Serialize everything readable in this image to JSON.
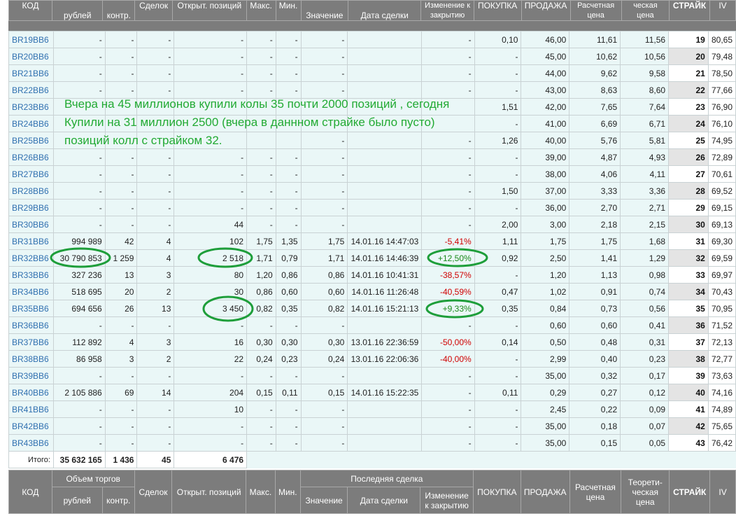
{
  "header_top": {
    "code": "КОД",
    "rub": "рублей",
    "contr": "контр.",
    "deals": "Сделок",
    "open_pos": "Открыт. позиций",
    "max": "Макс.",
    "min": "Мин.",
    "value": "Значение",
    "deal_date": "Дата сделки",
    "change": "Изменение к закрытию",
    "buy": "ПОКУПКА",
    "sell": "ПРОДАЖА",
    "calc_price": "Расчетная цена",
    "theor_price": "ческая цена",
    "strike": "СТРАЙК",
    "iv": "IV"
  },
  "rows": [
    {
      "code": "BR19BB6",
      "rub": "-",
      "contr": "-",
      "deals": "-",
      "open_pos": "-",
      "max": "-",
      "min": "-",
      "value": "-",
      "date": "",
      "chg": "-",
      "buy": "0,10",
      "sell": "46,00",
      "calc": "11,61",
      "theor": "11,56",
      "strike": "19",
      "iv": "80,65"
    },
    {
      "code": "BR20BB6",
      "rub": "-",
      "contr": "-",
      "deals": "-",
      "open_pos": "-",
      "max": "-",
      "min": "-",
      "value": "-",
      "date": "",
      "chg": "-",
      "buy": "-",
      "sell": "45,00",
      "calc": "10,62",
      "theor": "10,56",
      "strike": "20",
      "iv": "79,48"
    },
    {
      "code": "BR21BB6",
      "rub": "-",
      "contr": "-",
      "deals": "-",
      "open_pos": "-",
      "max": "-",
      "min": "-",
      "value": "-",
      "date": "",
      "chg": "-",
      "buy": "-",
      "sell": "44,00",
      "calc": "9,62",
      "theor": "9,58",
      "strike": "21",
      "iv": "78,50"
    },
    {
      "code": "BR22BB6",
      "rub": "-",
      "contr": "-",
      "deals": "-",
      "open_pos": "-",
      "max": "-",
      "min": "-",
      "value": "-",
      "date": "",
      "chg": "-",
      "buy": "-",
      "sell": "43,00",
      "calc": "8,63",
      "theor": "8,60",
      "strike": "22",
      "iv": "77,66"
    },
    {
      "code": "BR23BB6",
      "rub": "",
      "contr": "",
      "deals": "",
      "open_pos": "",
      "max": "",
      "min": "",
      "value": "",
      "date": "",
      "chg": "",
      "buy": "1,51",
      "sell": "42,00",
      "calc": "7,65",
      "theor": "7,64",
      "strike": "23",
      "iv": "76,90"
    },
    {
      "code": "BR24BB6",
      "rub": "",
      "contr": "",
      "deals": "",
      "open_pos": "",
      "max": "",
      "min": "",
      "value": "",
      "date": "",
      "chg": "",
      "buy": "-",
      "sell": "41,00",
      "calc": "6,69",
      "theor": "6,71",
      "strike": "24",
      "iv": "76,10"
    },
    {
      "code": "BR25BB6",
      "rub": "",
      "contr": "",
      "deals": "",
      "open_pos": "",
      "max": "",
      "min": "",
      "value": "-",
      "date": "",
      "chg": "-",
      "buy": "1,26",
      "sell": "40,00",
      "calc": "5,76",
      "theor": "5,81",
      "strike": "25",
      "iv": "74,95"
    },
    {
      "code": "BR26BB6",
      "rub": "-",
      "contr": "-",
      "deals": "-",
      "open_pos": "-",
      "max": "-",
      "min": "-",
      "value": "-",
      "date": "",
      "chg": "-",
      "buy": "-",
      "sell": "39,00",
      "calc": "4,87",
      "theor": "4,93",
      "strike": "26",
      "iv": "72,89"
    },
    {
      "code": "BR27BB6",
      "rub": "-",
      "contr": "-",
      "deals": "-",
      "open_pos": "-",
      "max": "-",
      "min": "-",
      "value": "-",
      "date": "",
      "chg": "-",
      "buy": "-",
      "sell": "38,00",
      "calc": "4,06",
      "theor": "4,11",
      "strike": "27",
      "iv": "70,61"
    },
    {
      "code": "BR28BB6",
      "rub": "-",
      "contr": "-",
      "deals": "-",
      "open_pos": "-",
      "max": "-",
      "min": "-",
      "value": "-",
      "date": "",
      "chg": "-",
      "buy": "1,50",
      "sell": "37,00",
      "calc": "3,33",
      "theor": "3,36",
      "strike": "28",
      "iv": "69,52"
    },
    {
      "code": "BR29BB6",
      "rub": "-",
      "contr": "-",
      "deals": "-",
      "open_pos": "-",
      "max": "-",
      "min": "-",
      "value": "-",
      "date": "",
      "chg": "-",
      "buy": "-",
      "sell": "36,00",
      "calc": "2,70",
      "theor": "2,71",
      "strike": "29",
      "iv": "69,15"
    },
    {
      "code": "BR30BB6",
      "rub": "-",
      "contr": "-",
      "deals": "-",
      "open_pos": "44",
      "max": "-",
      "min": "-",
      "value": "-",
      "date": "",
      "chg": "-",
      "buy": "2,00",
      "sell": "3,00",
      "calc": "2,18",
      "theor": "2,15",
      "strike": "30",
      "iv": "69,13"
    },
    {
      "code": "BR31BB6",
      "rub": "994 989",
      "contr": "42",
      "deals": "4",
      "open_pos": "102",
      "max": "1,75",
      "min": "1,35",
      "value": "1,75",
      "date": "14.01.16 14:47:03",
      "chg": "-5,41%",
      "buy": "1,11",
      "sell": "1,75",
      "calc": "1,75",
      "theor": "1,68",
      "strike": "31",
      "iv": "69,30"
    },
    {
      "code": "BR32BB6",
      "rub": "30 790 853",
      "contr": "1 259",
      "deals": "4",
      "open_pos": "2 518",
      "max": "1,71",
      "min": "0,79",
      "value": "1,71",
      "date": "14.01.16 14:46:39",
      "chg": "+12,50%",
      "buy": "0,92",
      "sell": "2,50",
      "calc": "1,41",
      "theor": "1,29",
      "strike": "32",
      "iv": "69,59"
    },
    {
      "code": "BR33BB6",
      "rub": "327 236",
      "contr": "13",
      "deals": "3",
      "open_pos": "80",
      "max": "1,20",
      "min": "0,86",
      "value": "0,86",
      "date": "14.01.16 10:41:31",
      "chg": "-38,57%",
      "buy": "-",
      "sell": "1,20",
      "calc": "1,13",
      "theor": "0,98",
      "strike": "33",
      "iv": "69,97"
    },
    {
      "code": "BR34BB6",
      "rub": "518 695",
      "contr": "20",
      "deals": "2",
      "open_pos": "30",
      "max": "0,86",
      "min": "0,60",
      "value": "0,60",
      "date": "14.01.16 11:26:48",
      "chg": "-40,59%",
      "buy": "0,47",
      "sell": "1,02",
      "calc": "0,91",
      "theor": "0,74",
      "strike": "34",
      "iv": "70,43"
    },
    {
      "code": "BR35BB6",
      "rub": "694 656",
      "contr": "26",
      "deals": "13",
      "open_pos": "3 450",
      "max": "0,82",
      "min": "0,35",
      "value": "0,82",
      "date": "14.01.16 15:21:13",
      "chg": "+9,33%",
      "buy": "0,35",
      "sell": "0,84",
      "calc": "0,73",
      "theor": "0,56",
      "strike": "35",
      "iv": "70,95"
    },
    {
      "code": "BR36BB6",
      "rub": "-",
      "contr": "-",
      "deals": "-",
      "open_pos": "-",
      "max": "-",
      "min": "-",
      "value": "-",
      "date": "",
      "chg": "-",
      "buy": "-",
      "sell": "0,60",
      "calc": "0,60",
      "theor": "0,41",
      "strike": "36",
      "iv": "71,52"
    },
    {
      "code": "BR37BB6",
      "rub": "112 892",
      "contr": "4",
      "deals": "3",
      "open_pos": "16",
      "max": "0,30",
      "min": "0,30",
      "value": "0,30",
      "date": "13.01.16 22:36:59",
      "chg": "-50,00%",
      "buy": "0,14",
      "sell": "0,50",
      "calc": "0,48",
      "theor": "0,31",
      "strike": "37",
      "iv": "72,13"
    },
    {
      "code": "BR38BB6",
      "rub": "86 958",
      "contr": "3",
      "deals": "2",
      "open_pos": "22",
      "max": "0,24",
      "min": "0,23",
      "value": "0,24",
      "date": "13.01.16 22:06:36",
      "chg": "-40,00%",
      "buy": "-",
      "sell": "2,99",
      "calc": "0,40",
      "theor": "0,23",
      "strike": "38",
      "iv": "72,77"
    },
    {
      "code": "BR39BB6",
      "rub": "-",
      "contr": "-",
      "deals": "-",
      "open_pos": "-",
      "max": "-",
      "min": "-",
      "value": "-",
      "date": "",
      "chg": "-",
      "buy": "-",
      "sell": "35,00",
      "calc": "0,32",
      "theor": "0,17",
      "strike": "39",
      "iv": "73,63"
    },
    {
      "code": "BR40BB6",
      "rub": "2 105 886",
      "contr": "69",
      "deals": "14",
      "open_pos": "204",
      "max": "0,15",
      "min": "0,11",
      "value": "0,15",
      "date": "14.01.16 15:22:35",
      "chg": "-",
      "buy": "0,11",
      "sell": "0,29",
      "calc": "0,27",
      "theor": "0,12",
      "strike": "40",
      "iv": "74,16"
    },
    {
      "code": "BR41BB6",
      "rub": "-",
      "contr": "-",
      "deals": "-",
      "open_pos": "10",
      "max": "-",
      "min": "-",
      "value": "-",
      "date": "",
      "chg": "-",
      "buy": "-",
      "sell": "2,45",
      "calc": "0,22",
      "theor": "0,09",
      "strike": "41",
      "iv": "74,89"
    },
    {
      "code": "BR42BB6",
      "rub": "-",
      "contr": "-",
      "deals": "-",
      "open_pos": "-",
      "max": "-",
      "min": "-",
      "value": "-",
      "date": "",
      "chg": "-",
      "buy": "-",
      "sell": "35,00",
      "calc": "0,18",
      "theor": "0,07",
      "strike": "42",
      "iv": "75,65"
    },
    {
      "code": "BR43BB6",
      "rub": "-",
      "contr": "-",
      "deals": "-",
      "open_pos": "-",
      "max": "-",
      "min": "-",
      "value": "-",
      "date": "",
      "chg": "-",
      "buy": "-",
      "sell": "35,00",
      "calc": "0,15",
      "theor": "0,05",
      "strike": "43",
      "iv": "76,42"
    }
  ],
  "totals": {
    "label": "Итого:",
    "rub": "35 632 165",
    "contr": "1 436",
    "deals": "45",
    "open_pos": "6 476"
  },
  "header_bottom": {
    "code": "КОД",
    "volume": "Объем торгов",
    "rub": "рублей",
    "contr": "контр.",
    "deals": "Сделок",
    "open_pos": "Открыт. позиций",
    "max": "Макс.",
    "min": "Мин.",
    "last_deal": "Последняя сделка",
    "value": "Значение",
    "deal_date": "Дата сделки",
    "change": "Изменение к закрытию",
    "buy": "ПОКУПКА",
    "sell": "ПРОДАЖА",
    "calc_price": "Расчетная цена",
    "theor_price": "Теорети-ческая цена",
    "strike": "СТРАЙК",
    "iv": "IV"
  },
  "annotation": {
    "line1": "Вчера на 45 миллионов купили колы 35 почти 2000 позиций , сегодня",
    "line2": "Купили на 31 миллион 2500 (вчера в даннном страйке было пусто)",
    "line3": "позиций колл с страйком 32.",
    "color": "#22aa33"
  },
  "colors": {
    "header_bg": "#7c7c7c",
    "row_bg": "#eaf7f7",
    "link": "#3070b0",
    "negative": "#d00000",
    "positive": "#1a8a1a",
    "circle": "#1e9e3a"
  }
}
